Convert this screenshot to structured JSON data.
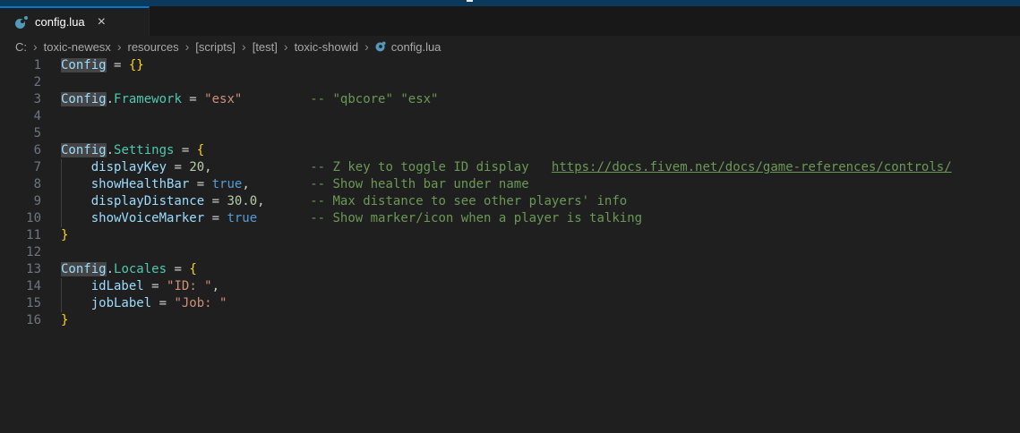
{
  "window": {
    "titlebar_color": "#0b3a5d",
    "accent_color": "#0078d4",
    "editor_bg": "#1f1f1f",
    "tabstrip_bg": "#181818"
  },
  "tab": {
    "label": "config.lua",
    "close_icon": "×",
    "file_icon": "lua-icon"
  },
  "breadcrumb": {
    "separator": "›",
    "items": [
      "C:",
      "toxic-newesx",
      "resources",
      "[scripts]",
      "[test]",
      "toxic-showid",
      "config.lua"
    ]
  },
  "editor": {
    "language": "lua",
    "token_colors": {
      "variable": "#9cdcfe",
      "property": "#4ec9b0",
      "string": "#ce9178",
      "number": "#b5cea8",
      "boolean": "#569cd6",
      "comment": "#6a9955",
      "brace": "#ffd700",
      "default": "#cccccc",
      "line_number": "#6e7681",
      "word_highlight_bg": "rgba(90,90,90,0.65)"
    },
    "indent_guides": [
      {
        "col": 0,
        "from_line": 7,
        "to_line": 10
      },
      {
        "col": 0,
        "from_line": 14,
        "to_line": 15
      }
    ],
    "lines": [
      {
        "n": 1,
        "tokens": [
          [
            "Config",
            "v h"
          ],
          [
            " = ",
            "o"
          ],
          [
            "{}",
            "b"
          ]
        ]
      },
      {
        "n": 2,
        "tokens": []
      },
      {
        "n": 3,
        "tokens": [
          [
            "Config",
            "v h"
          ],
          [
            ".",
            "o"
          ],
          [
            "Framework",
            "p"
          ],
          [
            " = ",
            "o"
          ],
          [
            "\"esx\"",
            "s"
          ],
          [
            "         ",
            "o"
          ],
          [
            "-- \"qbcore\" \"esx\"",
            "c"
          ]
        ]
      },
      {
        "n": 4,
        "tokens": []
      },
      {
        "n": 5,
        "tokens": []
      },
      {
        "n": 6,
        "tokens": [
          [
            "Config",
            "v h"
          ],
          [
            ".",
            "o"
          ],
          [
            "Settings",
            "p"
          ],
          [
            " = ",
            "o"
          ],
          [
            "{",
            "b"
          ]
        ]
      },
      {
        "n": 7,
        "tokens": [
          [
            "    ",
            "o"
          ],
          [
            "displayKey",
            "v"
          ],
          [
            " = ",
            "o"
          ],
          [
            "20",
            "n"
          ],
          [
            ",",
            "o"
          ],
          [
            "             ",
            "o"
          ],
          [
            "-- Z key to toggle ID display   ",
            "c"
          ],
          [
            "https://docs.fivem.net/docs/game-references/controls/",
            "cl"
          ]
        ]
      },
      {
        "n": 8,
        "tokens": [
          [
            "    ",
            "o"
          ],
          [
            "showHealthBar",
            "v"
          ],
          [
            " = ",
            "o"
          ],
          [
            "true",
            "t"
          ],
          [
            ",",
            "o"
          ],
          [
            "        ",
            "o"
          ],
          [
            "-- Show health bar under name",
            "c"
          ]
        ]
      },
      {
        "n": 9,
        "tokens": [
          [
            "    ",
            "o"
          ],
          [
            "displayDistance",
            "v"
          ],
          [
            " = ",
            "o"
          ],
          [
            "30.0",
            "n"
          ],
          [
            ",",
            "o"
          ],
          [
            "      ",
            "o"
          ],
          [
            "-- Max distance to see other players' info",
            "c"
          ]
        ]
      },
      {
        "n": 10,
        "tokens": [
          [
            "    ",
            "o"
          ],
          [
            "showVoiceMarker",
            "v"
          ],
          [
            " = ",
            "o"
          ],
          [
            "true",
            "t"
          ],
          [
            "       ",
            "o"
          ],
          [
            "-- Show marker/icon when a player is talking",
            "c"
          ]
        ]
      },
      {
        "n": 11,
        "tokens": [
          [
            "}",
            "b"
          ]
        ]
      },
      {
        "n": 12,
        "tokens": []
      },
      {
        "n": 13,
        "tokens": [
          [
            "Config",
            "v h"
          ],
          [
            ".",
            "o"
          ],
          [
            "Locales",
            "p"
          ],
          [
            " = ",
            "o"
          ],
          [
            "{",
            "b"
          ]
        ]
      },
      {
        "n": 14,
        "tokens": [
          [
            "    ",
            "o"
          ],
          [
            "idLabel",
            "v"
          ],
          [
            " = ",
            "o"
          ],
          [
            "\"ID: \"",
            "s"
          ],
          [
            ",",
            "o"
          ]
        ]
      },
      {
        "n": 15,
        "tokens": [
          [
            "    ",
            "o"
          ],
          [
            "jobLabel",
            "v"
          ],
          [
            " = ",
            "o"
          ],
          [
            "\"Job: \"",
            "s"
          ]
        ]
      },
      {
        "n": 16,
        "tokens": [
          [
            "}",
            "b"
          ]
        ]
      }
    ]
  }
}
